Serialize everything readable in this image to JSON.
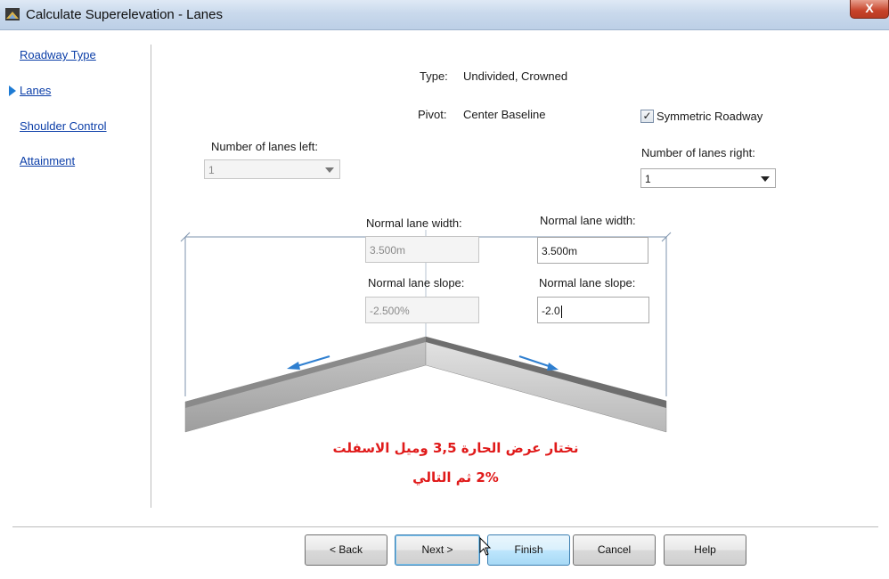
{
  "window": {
    "title": "Calculate Superelevation - Lanes",
    "close_label": "X"
  },
  "nav": {
    "items": [
      {
        "label": "Roadway Type",
        "active": false
      },
      {
        "label": "Lanes",
        "active": true
      },
      {
        "label": "Shoulder Control",
        "active": false
      },
      {
        "label": "Attainment",
        "active": false
      }
    ]
  },
  "info": {
    "type_label": "Type:",
    "type_value": "Undivided, Crowned",
    "pivot_label": "Pivot:",
    "pivot_value": "Center Baseline"
  },
  "symmetric": {
    "label": "Symmetric Roadway",
    "checked": true
  },
  "left": {
    "lanes_label": "Number of lanes left:",
    "lanes_value": "1",
    "width_label": "Normal lane width:",
    "width_value": "3.500m",
    "slope_label": "Normal lane slope:",
    "slope_value": "-2.500%"
  },
  "right": {
    "lanes_label": "Number of lanes right:",
    "lanes_value": "1",
    "width_label": "Normal lane width:",
    "width_value": "3.500m",
    "slope_label": "Normal lane slope:",
    "slope_value": "-2.0"
  },
  "overlay": {
    "line1": "نختار عرض الحارة 3,5 وميل الاسفلت",
    "line2": "2% ثم التالي"
  },
  "buttons": {
    "back": "< Back",
    "next": "Next >",
    "finish": "Finish",
    "cancel": "Cancel",
    "help": "Help"
  },
  "colors": {
    "link": "#0b3ea8",
    "nav_arrow": "#1e7bd4",
    "overlay_text": "#e01a1a",
    "slope_arrow": "#2f7fd0"
  }
}
